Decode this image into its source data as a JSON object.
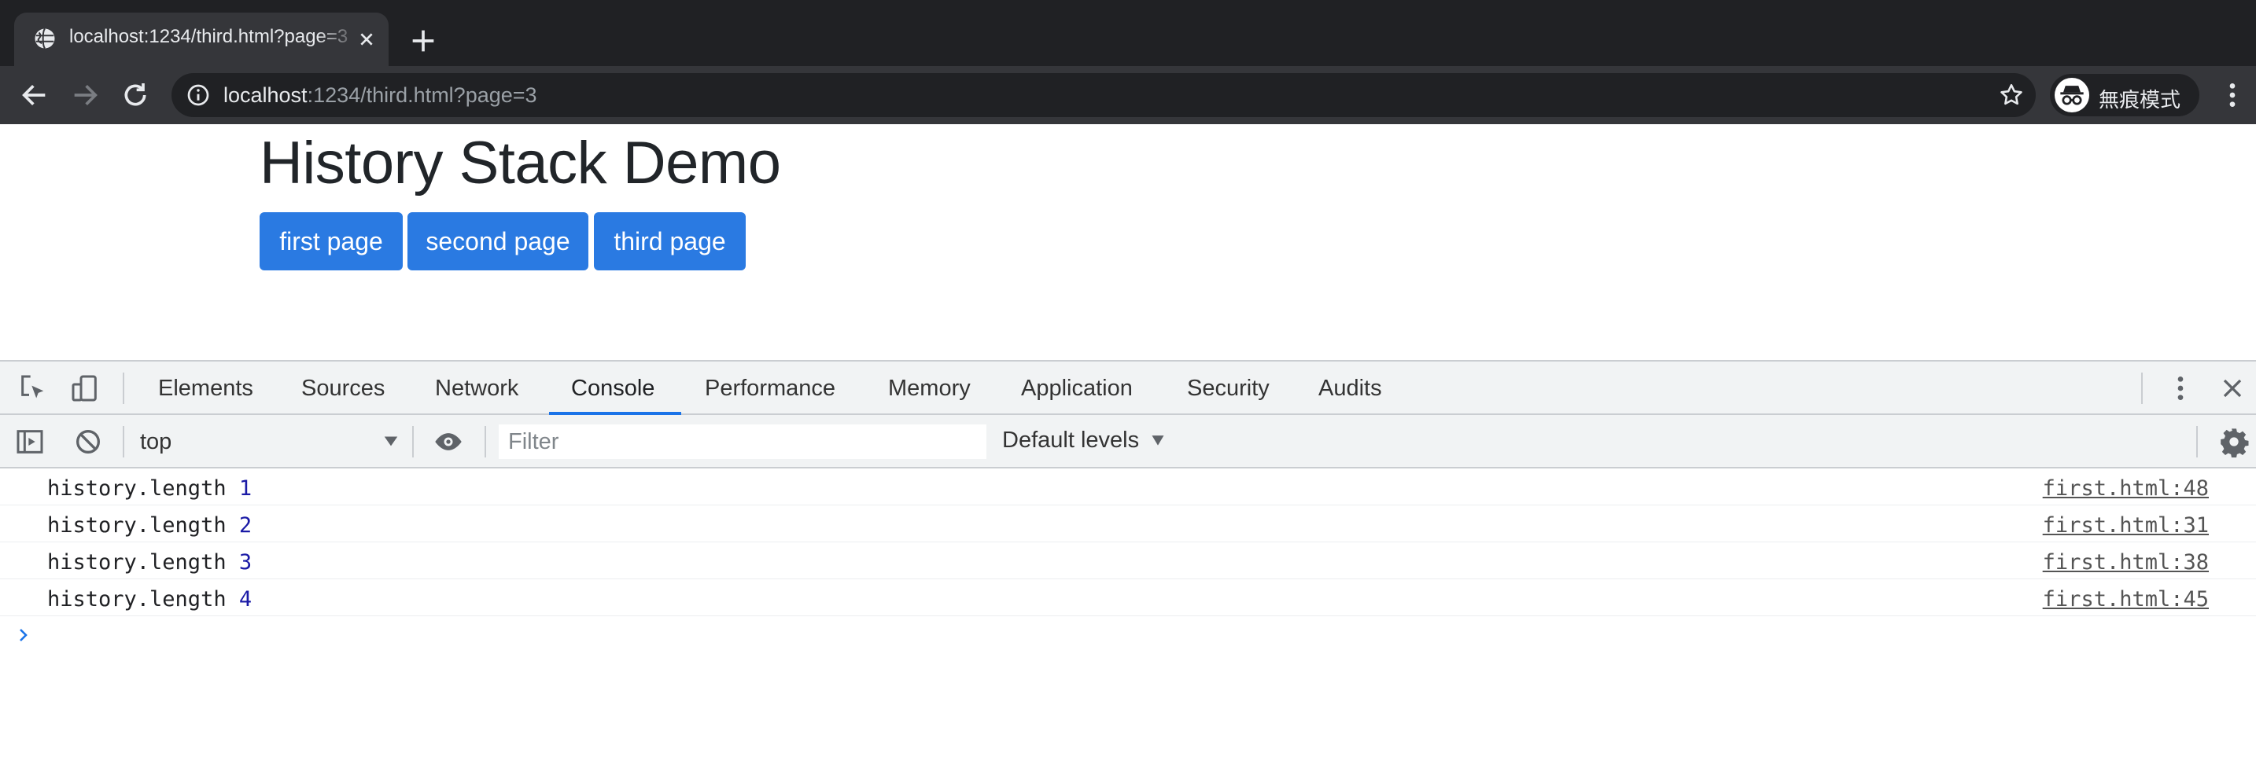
{
  "browser": {
    "tab": {
      "title": "localhost:1234/third.html?page=3"
    },
    "address": {
      "host": "localhost",
      "rest": ":1234/third.html?page=3"
    },
    "profile": {
      "label": "無痕模式"
    }
  },
  "page": {
    "title": "History Stack Demo",
    "buttons": [
      {
        "label": "first page"
      },
      {
        "label": "second page"
      },
      {
        "label": "third page"
      }
    ]
  },
  "devtools": {
    "tabs": [
      {
        "label": "Elements"
      },
      {
        "label": "Sources"
      },
      {
        "label": "Network"
      },
      {
        "label": "Console"
      },
      {
        "label": "Performance"
      },
      {
        "label": "Memory"
      },
      {
        "label": "Application"
      },
      {
        "label": "Security"
      },
      {
        "label": "Audits"
      }
    ],
    "active_tab": "Console",
    "context": "top",
    "filter_placeholder": "Filter",
    "levels_label": "Default levels",
    "logs": [
      {
        "text": "history.length ",
        "value": "1",
        "source": "first.html:48"
      },
      {
        "text": "history.length ",
        "value": "2",
        "source": "first.html:31"
      },
      {
        "text": "history.length ",
        "value": "3",
        "source": "first.html:38"
      },
      {
        "text": "history.length ",
        "value": "4",
        "source": "first.html:45"
      }
    ]
  },
  "colors": {
    "accent_button": "#2a7ae2",
    "active_tab_underline": "#1a73e8",
    "console_number": "#1a1aa6"
  }
}
